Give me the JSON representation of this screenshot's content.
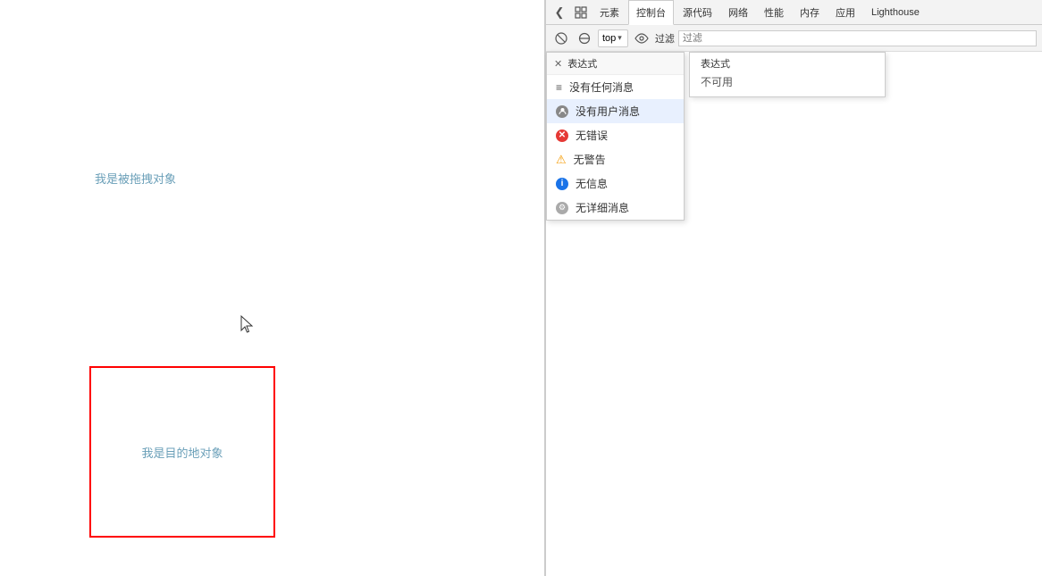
{
  "page": {
    "drag_source_label": "我是被拖拽对象",
    "drop_target_label": "我是目的地对象"
  },
  "devtools": {
    "tabs": [
      {
        "label": "元素",
        "active": false
      },
      {
        "label": "控制台",
        "active": true
      },
      {
        "label": "源代码",
        "active": false
      },
      {
        "label": "网络",
        "active": false
      },
      {
        "label": "性能",
        "active": false
      },
      {
        "label": "内存",
        "active": false
      },
      {
        "label": "应用",
        "active": false
      },
      {
        "label": "Lighthouse",
        "active": false
      }
    ],
    "toolbar": {
      "frame_label": "top",
      "filter_placeholder": "过滤"
    },
    "dropdown": {
      "title": "表达式",
      "unavailable": "不可用",
      "items": [
        {
          "icon": "list",
          "label": "没有任何消息"
        },
        {
          "icon": "user",
          "label": "没有用户消息"
        },
        {
          "icon": "error",
          "label": "无错误"
        },
        {
          "icon": "warning",
          "label": "无警告"
        },
        {
          "icon": "info",
          "label": "无信息"
        },
        {
          "icon": "verbose",
          "label": "无详细消息"
        }
      ]
    }
  }
}
